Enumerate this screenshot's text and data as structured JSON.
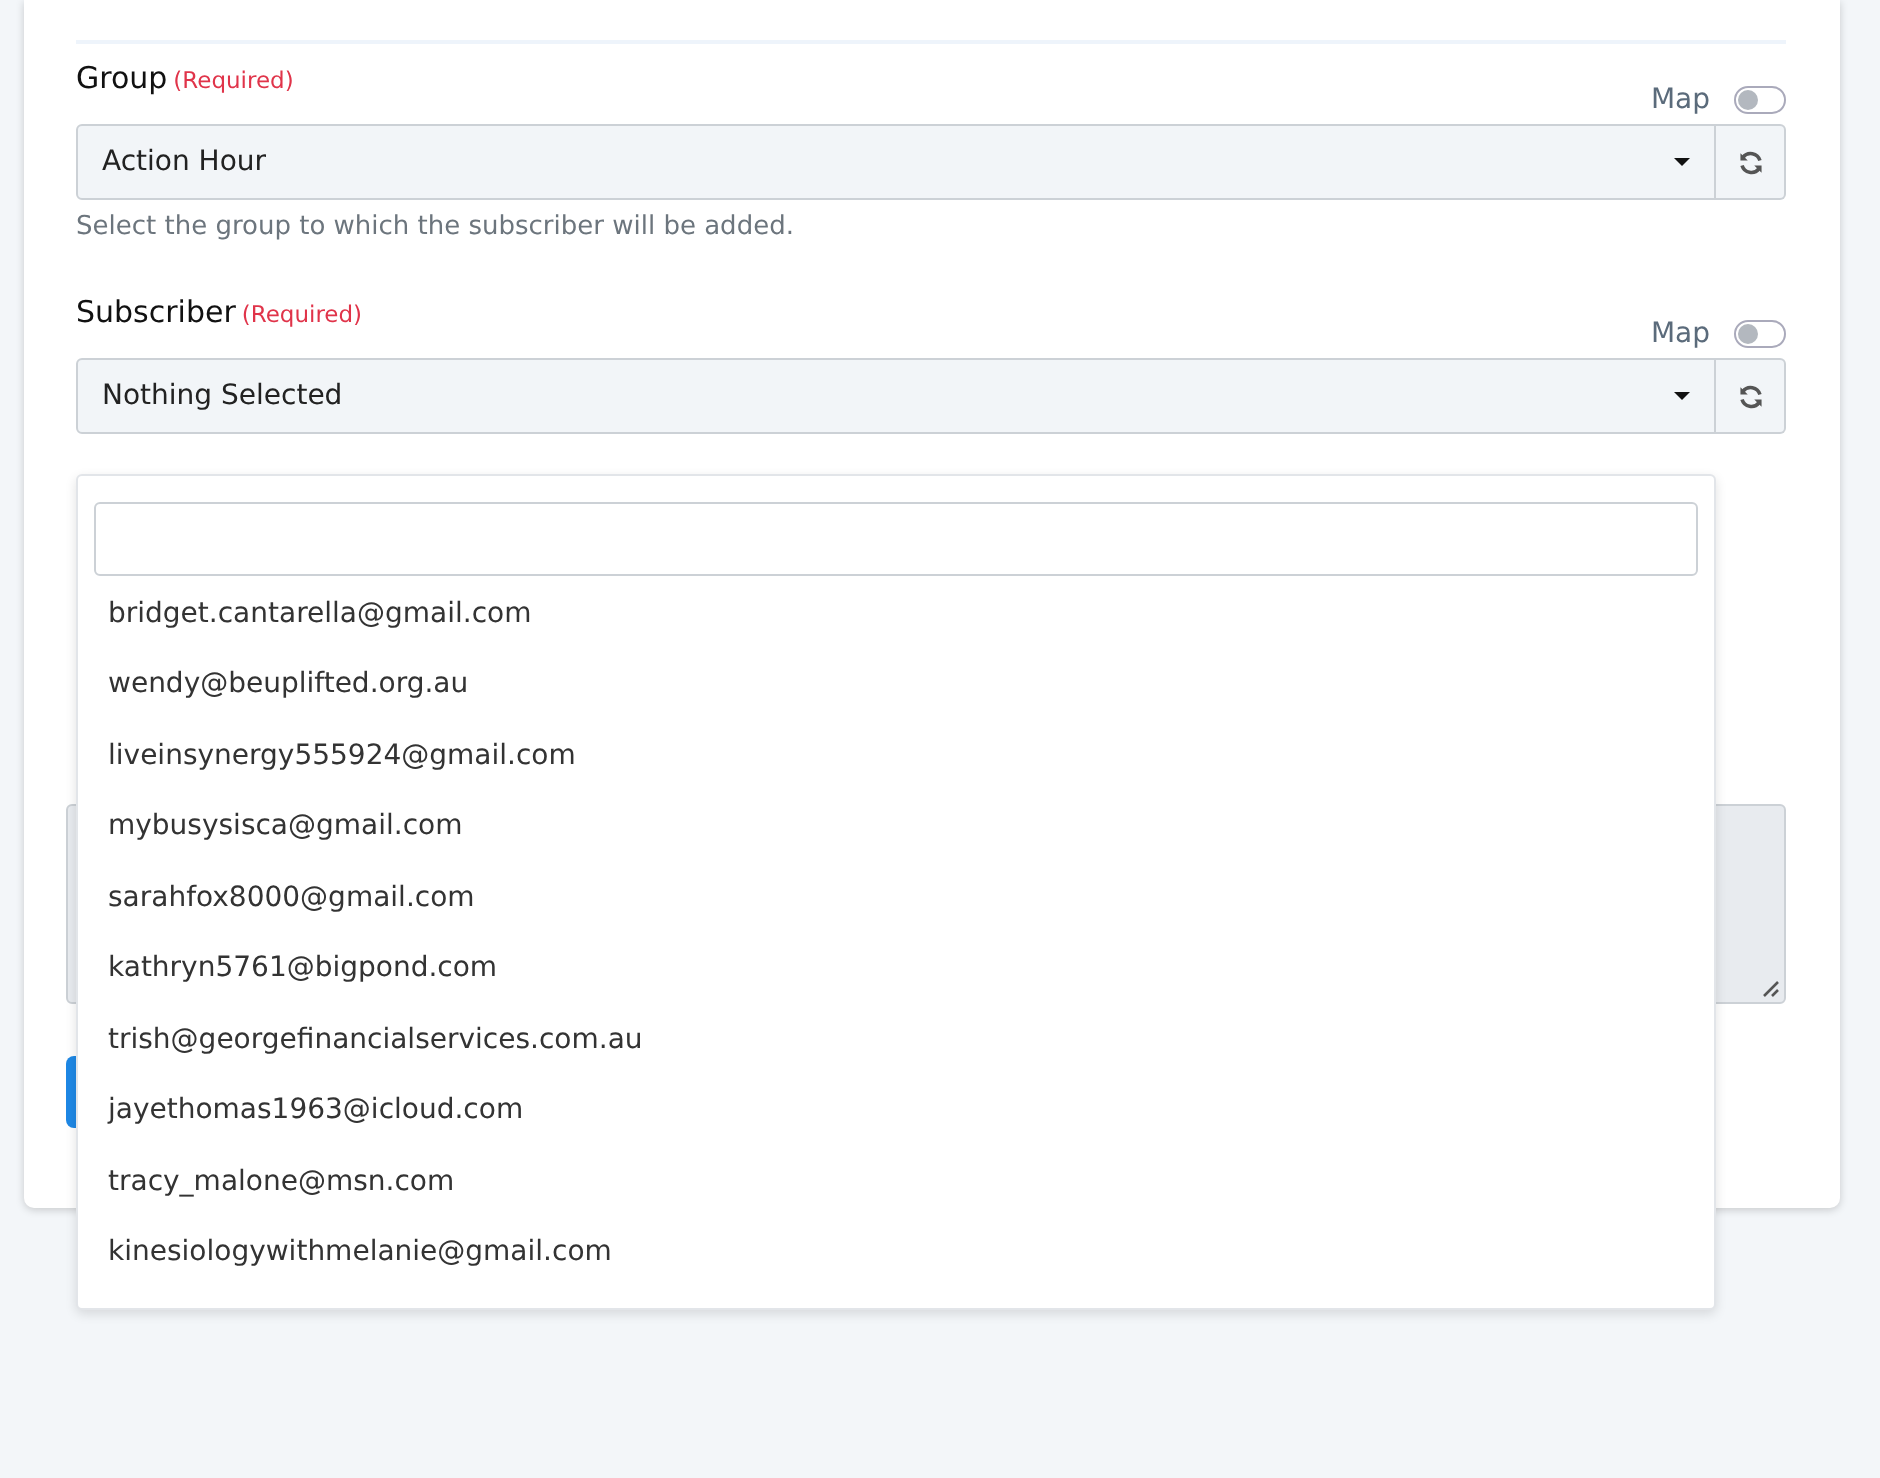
{
  "fields": [
    {
      "label": "Group",
      "required_note": "(Required)",
      "map_label": "Map",
      "map_on": false,
      "value": "Action Hour",
      "help": "Select the group to which the subscriber will be added."
    },
    {
      "label": "Subscriber",
      "required_note": "(Required)",
      "map_label": "Map",
      "map_on": false,
      "value": "Nothing Selected"
    }
  ],
  "dropdown": {
    "options": [
      "bridget.cantarella@gmail.com",
      "wendy@beuplifted.org.au",
      "liveinsynergy555924@gmail.com",
      "mybusysisca@gmail.com",
      "sarahfox8000@gmail.com",
      "kathryn5761@bigpond.com",
      "trish@georgefinancialservices.com.au",
      "jayethomas1963@icloud.com",
      "tracy_malone@msn.com",
      "kinesiologywithmelanie@gmail.com"
    ]
  }
}
